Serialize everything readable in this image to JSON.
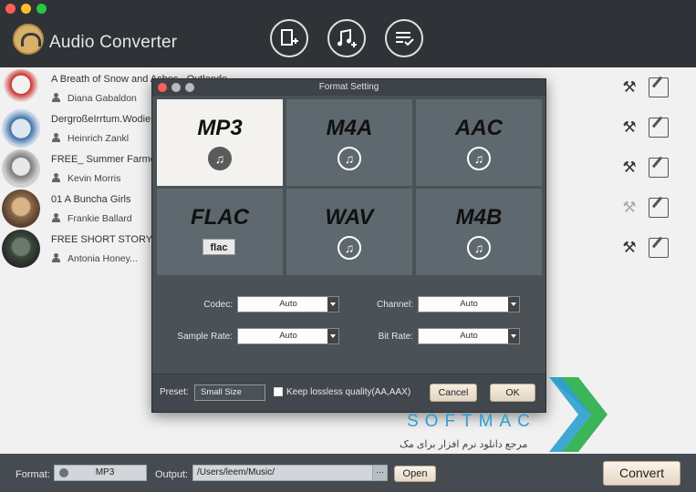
{
  "app": {
    "title": "Audio Converter",
    "header_buttons": [
      "add-book-icon",
      "add-music-icon",
      "list-check-icon"
    ]
  },
  "rows": [
    {
      "title": "A Breath of Snow and Ashes_ Outlande",
      "author": "Diana Gabaldon",
      "thumb_color": "#c9302c"
    },
    {
      "title": "DergroßeIrrtum.Wodie",
      "author": "Heinrich Zankl",
      "thumb_color": "#3b6ea8"
    },
    {
      "title": "FREE_ Summer Farmer",
      "author": "Kevin Morris",
      "thumb_color": "#7a7a7a"
    },
    {
      "title": "01 A Buncha Girls",
      "author": "Frankie Ballard",
      "thumb_color": "#8a6a4a"
    },
    {
      "title": "FREE SHORT STORY_",
      "author": "Antonia Honey...",
      "thumb_color": "#3a4a3a"
    }
  ],
  "dialog": {
    "title": "Format Setting",
    "formats": [
      {
        "name": "MP3",
        "selected": true,
        "icon": "music-note-icon"
      },
      {
        "name": "M4A",
        "selected": false,
        "icon": "music-note-icon"
      },
      {
        "name": "AAC",
        "selected": false,
        "icon": "music-note-icon"
      },
      {
        "name": "FLAC",
        "selected": false,
        "icon": "flac-icon",
        "badge": "flac"
      },
      {
        "name": "WAV",
        "selected": false,
        "icon": "music-note-icon"
      },
      {
        "name": "M4B",
        "selected": false,
        "icon": "music-note-icon"
      }
    ],
    "codec_label": "Codec:",
    "codec_value": "Auto",
    "channel_label": "Channel:",
    "channel_value": "Auto",
    "sample_rate_label": "Sample Rate:",
    "sample_rate_value": "Auto",
    "bit_rate_label": "Bit Rate:",
    "bit_rate_value": "Auto",
    "preset_label": "Preset:",
    "preset_value": "Small Size",
    "lossless_label": "Keep lossless quality(AA,AAX)",
    "cancel_label": "Cancel",
    "ok_label": "OK"
  },
  "footer": {
    "format_label": "Format:",
    "format_value": "MP3",
    "output_label": "Output:",
    "output_value": "/Users/leem/Music/",
    "browse_label": "···",
    "open_label": "Open",
    "convert_label": "Convert"
  },
  "watermark": {
    "text": "SOFTMAC",
    "subtext": "مرجع دانلود نرم افزار برای مک",
    "colors": [
      "#2d9fd0",
      "#3cb45a"
    ]
  }
}
